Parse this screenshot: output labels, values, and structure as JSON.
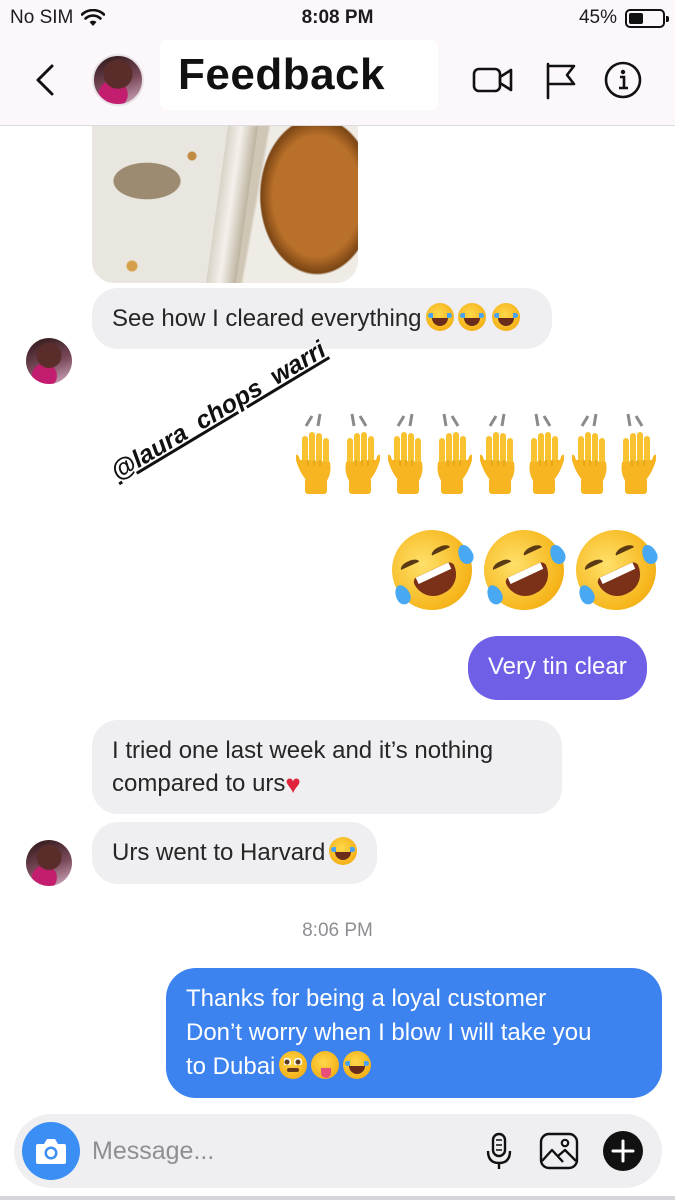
{
  "status_bar": {
    "carrier": "No SIM",
    "time": "8:08 PM",
    "battery_percent_label": "45%",
    "battery_level": 0.45
  },
  "header": {
    "title": "Feedback",
    "icons": [
      "chevron-left-icon",
      "video-camera-icon",
      "flag-icon",
      "info-icon"
    ]
  },
  "messages": [
    {
      "sender": "contact",
      "type": "image",
      "description_icon": "food-tray-photo"
    },
    {
      "sender": "contact",
      "type": "text",
      "text": "See how I cleared everything",
      "emoji": [
        "laughing-tears",
        "laughing-tears",
        "laughing-tears"
      ]
    },
    {
      "sender": "self",
      "type": "emoji",
      "emoji": [
        "raised-hands",
        "raised-hands",
        "raised-hands",
        "raised-hands"
      ]
    },
    {
      "sender": "self",
      "type": "emoji",
      "emoji": [
        "rolling-on-floor-laughing",
        "rolling-on-floor-laughing",
        "rolling-on-floor-laughing"
      ]
    },
    {
      "sender": "self",
      "type": "text",
      "text": "Very tin clear",
      "color": "#6f5fe6"
    },
    {
      "sender": "contact",
      "type": "text",
      "text_line1": "I tried one last week and it’s nothing",
      "text_line2": "compared to urs",
      "emoji": [
        "red-heart"
      ]
    },
    {
      "sender": "contact",
      "type": "text",
      "text": "Urs went to Harvard",
      "emoji": [
        "laughing-tears"
      ]
    },
    {
      "sender": "self",
      "type": "text",
      "text_line1": "Thanks for being a loyal customer",
      "text_line2": "Don’t worry when I blow I will take you",
      "text_line3": "to Dubai",
      "emoji": [
        "rolling-eyes",
        "zany-face",
        "rolling-on-floor-laughing"
      ],
      "color": "#3d83ef"
    }
  ],
  "sticker": {
    "text": "@laura_chops_warri"
  },
  "timestamp": "8:06 PM",
  "composer": {
    "placeholder": "Message...",
    "icons": [
      "camera-icon",
      "microphone-icon",
      "gallery-icon",
      "plus-icon"
    ]
  },
  "colors": {
    "accent_purple": "#6f5fe6",
    "accent_blue": "#3d83ef",
    "camera_button": "#3b8ef3",
    "incoming_bubble": "#efeef1",
    "header_bg": "#fbf7fb"
  }
}
